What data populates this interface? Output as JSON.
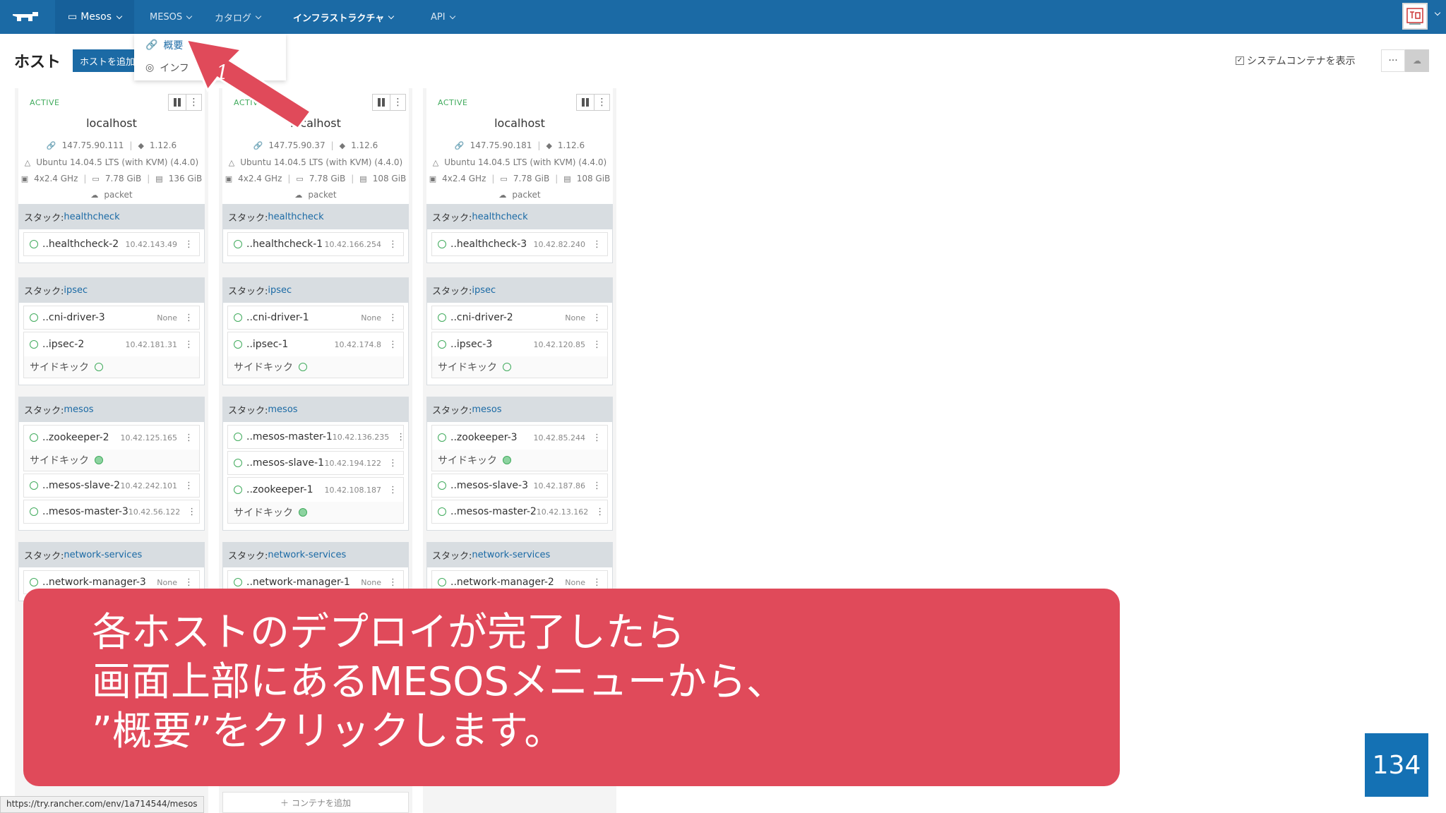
{
  "nav": {
    "env_label": "Mesos",
    "items": [
      {
        "label": "MESOS"
      },
      {
        "label": "カタログ"
      },
      {
        "label": "インフラストラクチャ"
      },
      {
        "label": "API"
      }
    ]
  },
  "dropdown": {
    "items": [
      {
        "label": "概要"
      },
      {
        "label": "インフ"
      }
    ]
  },
  "annotation": {
    "number": "1"
  },
  "header": {
    "title": "ホスト",
    "add_host": "ホストを追加",
    "system_containers": "システムコンテナを表示",
    "system_containers_checked": "✓",
    "more": "···"
  },
  "hosts": [
    {
      "state": "ACTIVE",
      "name": "localhost",
      "ip": "147.75.90.111",
      "docker": "1.12.6",
      "os": "Ubuntu 14.04.5 LTS (with KVM) (4.4.0)",
      "cpu": "4x2.4 GHz",
      "ram": "7.78 GiB",
      "disk": "136 GiB",
      "provider": "packet",
      "stacks": {
        "healthcheck": {
          "label": "スタック:",
          "name": "healthcheck",
          "c1": {
            "name": "..healthcheck-2",
            "ip": "10.42.143.49"
          }
        },
        "ipsec": {
          "label": "スタック:",
          "name": "ipsec",
          "c1": {
            "name": "..cni-driver-3",
            "ip": "None"
          },
          "c2": {
            "name": "..ipsec-2",
            "ip": "10.42.181.31"
          },
          "sidekick": "サイドキック"
        },
        "mesos": {
          "label": "スタック:",
          "name": "mesos",
          "c1": {
            "name": "..zookeeper-2",
            "ip": "10.42.125.165"
          },
          "sidekick": "サイドキック",
          "c2": {
            "name": "..mesos-slave-2",
            "ip": "10.42.242.101"
          },
          "c3": {
            "name": "..mesos-master-3",
            "ip": "10.42.56.122"
          }
        },
        "network": {
          "label": "スタック:",
          "name": "network-services",
          "c1": {
            "name": "..network-manager-3",
            "ip": "None"
          }
        }
      }
    },
    {
      "state": "ACTIVE",
      "name": "localhost",
      "ip": "147.75.90.37",
      "docker": "1.12.6",
      "os": "Ubuntu 14.04.5 LTS (with KVM) (4.4.0)",
      "cpu": "4x2.4 GHz",
      "ram": "7.78 GiB",
      "disk": "108 GiB",
      "provider": "packet",
      "stacks": {
        "healthcheck": {
          "label": "スタック:",
          "name": "healthcheck",
          "c1": {
            "name": "..healthcheck-1",
            "ip": "10.42.166.254"
          }
        },
        "ipsec": {
          "label": "スタック:",
          "name": "ipsec",
          "c1": {
            "name": "..cni-driver-1",
            "ip": "None"
          },
          "c2": {
            "name": "..ipsec-1",
            "ip": "10.42.174.8"
          },
          "sidekick": "サイドキック"
        },
        "mesos": {
          "label": "スタック:",
          "name": "mesos",
          "c1": {
            "name": "..mesos-master-1",
            "ip": "10.42.136.235"
          },
          "c2": {
            "name": "..mesos-slave-1",
            "ip": "10.42.194.122"
          },
          "c3": {
            "name": "..zookeeper-1",
            "ip": "10.42.108.187"
          },
          "sidekick": "サイドキック"
        },
        "network": {
          "label": "スタック:",
          "name": "network-services",
          "c1": {
            "name": "..network-manager-1",
            "ip": "None"
          }
        }
      },
      "add_container": "コンテナを追加"
    },
    {
      "state": "ACTIVE",
      "name": "localhost",
      "ip": "147.75.90.181",
      "docker": "1.12.6",
      "os": "Ubuntu 14.04.5 LTS (with KVM) (4.4.0)",
      "cpu": "4x2.4 GHz",
      "ram": "7.78 GiB",
      "disk": "108 GiB",
      "provider": "packet",
      "stacks": {
        "healthcheck": {
          "label": "スタック:",
          "name": "healthcheck",
          "c1": {
            "name": "..healthcheck-3",
            "ip": "10.42.82.240"
          }
        },
        "ipsec": {
          "label": "スタック:",
          "name": "ipsec",
          "c1": {
            "name": "..cni-driver-2",
            "ip": "None"
          },
          "c2": {
            "name": "..ipsec-3",
            "ip": "10.42.120.85"
          },
          "sidekick": "サイドキック"
        },
        "mesos": {
          "label": "スタック:",
          "name": "mesos",
          "c1": {
            "name": "..zookeeper-3",
            "ip": "10.42.85.244"
          },
          "sidekick": "サイドキック",
          "c2": {
            "name": "..mesos-slave-3",
            "ip": "10.42.187.86"
          },
          "c3": {
            "name": "..mesos-master-2",
            "ip": "10.42.13.162"
          }
        },
        "network": {
          "label": "スタック:",
          "name": "network-services",
          "c1": {
            "name": "..network-manager-2",
            "ip": "None"
          }
        }
      }
    }
  ],
  "callout": {
    "lines": [
      "各ホストのデプロイが完了したら",
      "画面上部にあるMESOSメニューから、",
      "”概要”をクリックします。"
    ]
  },
  "page_number": "134",
  "status_url": "https://try.rancher.com/env/1a714544/mesos",
  "colors": {
    "nav": "#1b6aa5",
    "callout": "#e04a5a",
    "arrow": "#e04a5a",
    "active": "#41ab5d"
  }
}
